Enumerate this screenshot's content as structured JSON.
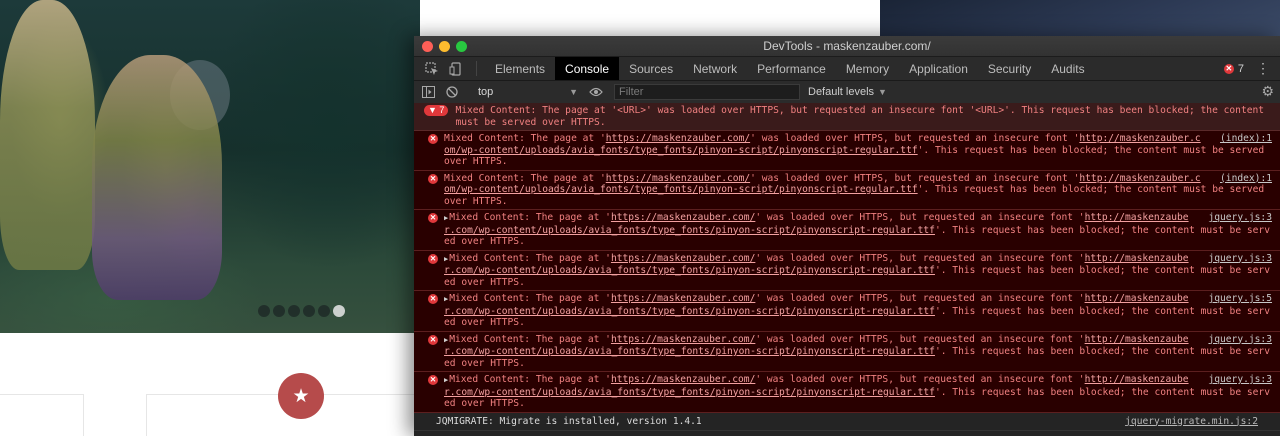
{
  "site": {
    "badge_glyph": "★",
    "slider_dots": 5
  },
  "devtools": {
    "window_title": "DevTools - maskenzauber.com/",
    "tabs": [
      {
        "label": "Elements",
        "active": false
      },
      {
        "label": "Console",
        "active": true
      },
      {
        "label": "Sources",
        "active": false
      },
      {
        "label": "Network",
        "active": false
      },
      {
        "label": "Performance",
        "active": false
      },
      {
        "label": "Memory",
        "active": false
      },
      {
        "label": "Application",
        "active": false
      },
      {
        "label": "Security",
        "active": false
      },
      {
        "label": "Audits",
        "active": false
      }
    ],
    "error_count": "7",
    "icons": {
      "inspect": "inspect-element-icon",
      "device": "device-toolbar-icon",
      "sidebar": "show-sidebar-icon",
      "clear": "clear-console-icon",
      "eye": "live-expression-eye-icon",
      "settings": "gear-icon",
      "more": "kebab-menu-icon"
    },
    "console_toolbar": {
      "context": "top",
      "filter_placeholder": "Filter",
      "levels": "Default levels"
    },
    "group": {
      "count": "7",
      "text": "Mixed Content: The page at '<URL>' was loaded over HTTPS, but requested an insecure font '<URL>'. This request has been blocked; the content must be served over HTTPS."
    },
    "messages": [
      {
        "expandable": false,
        "pre": "Mixed Content: The page at '",
        "page_url": "https://maskenzauber.com/",
        "mid": "' was loaded over HTTPS, but requested an insecure font '",
        "font_url": "http://maskenzauber.com/wp-content/uploads/avia_fonts/type_fonts/pinyon-script/pinyonscript-regular.ttf",
        "post": "'. This request has been blocked; the content must be served over HTTPS.",
        "source": "(index):1"
      },
      {
        "expandable": false,
        "pre": "Mixed Content: The page at '",
        "page_url": "https://maskenzauber.com/",
        "mid": "' was loaded over HTTPS, but requested an insecure font '",
        "font_url": "http://maskenzauber.com/wp-content/uploads/avia_fonts/type_fonts/pinyon-script/pinyonscript-regular.ttf",
        "post": "'. This request has been blocked; the content must be served over HTTPS.",
        "source": "(index):1"
      },
      {
        "expandable": true,
        "pre": "Mixed Content: The page at '",
        "page_url": "https://maskenzauber.com/",
        "mid": "' was loaded over HTTPS, but requested an insecure font '",
        "font_url": "http://maskenzauber.com/wp-content/uploads/avia_fonts/type_fonts/pinyon-script/pinyonscript-regular.ttf",
        "post": "'. This request has been blocked; the content must be served over HTTPS.",
        "source": "jquery.js:3"
      },
      {
        "expandable": true,
        "pre": "Mixed Content: The page at '",
        "page_url": "https://maskenzauber.com/",
        "mid": "' was loaded over HTTPS, but requested an insecure font '",
        "font_url": "http://maskenzauber.com/wp-content/uploads/avia_fonts/type_fonts/pinyon-script/pinyonscript-regular.ttf",
        "post": "'. This request has been blocked; the content must be served over HTTPS.",
        "source": "jquery.js:3"
      },
      {
        "expandable": true,
        "pre": "Mixed Content: The page at '",
        "page_url": "https://maskenzauber.com/",
        "mid": "' was loaded over HTTPS, but requested an insecure font '",
        "font_url": "http://maskenzauber.com/wp-content/uploads/avia_fonts/type_fonts/pinyon-script/pinyonscript-regular.ttf",
        "post": "'. This request has been blocked; the content must be served over HTTPS.",
        "source": "jquery.js:5"
      },
      {
        "expandable": true,
        "pre": "Mixed Content: The page at '",
        "page_url": "https://maskenzauber.com/",
        "mid": "' was loaded over HTTPS, but requested an insecure font '",
        "font_url": "http://maskenzauber.com/wp-content/uploads/avia_fonts/type_fonts/pinyon-script/pinyonscript-regular.ttf",
        "post": "'. This request has been blocked; the content must be served over HTTPS.",
        "source": "jquery.js:3"
      },
      {
        "expandable": true,
        "pre": "Mixed Content: The page at '",
        "page_url": "https://maskenzauber.com/",
        "mid": "' was loaded over HTTPS, but requested an insecure font '",
        "font_url": "http://maskenzauber.com/wp-content/uploads/avia_fonts/type_fonts/pinyon-script/pinyonscript-regular.ttf",
        "post": "'. This request has been blocked; the content must be served over HTTPS.",
        "source": "jquery.js:3"
      }
    ],
    "info": {
      "text": "JQMIGRATE: Migrate is installed, version 1.4.1",
      "source": "jquery-migrate.min.js:2"
    },
    "prompt": "›"
  },
  "colors": {
    "error_red": "#e0383b",
    "error_row_bg": "#290000",
    "error_text": "#f08080",
    "badge_red": "#b64b4b"
  }
}
